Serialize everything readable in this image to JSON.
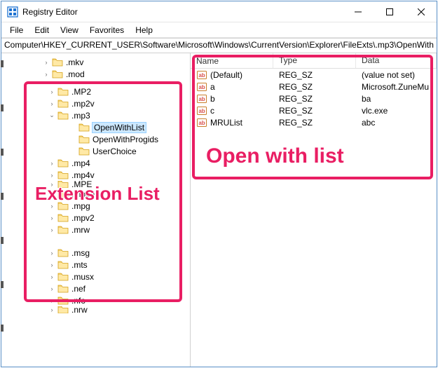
{
  "window": {
    "title": "Registry Editor"
  },
  "menubar": [
    "File",
    "Edit",
    "View",
    "Favorites",
    "Help"
  ],
  "address": "Computer\\HKEY_CURRENT_USER\\Software\\Microsoft\\Windows\\CurrentVersion\\Explorer\\FileExts\\.mp3\\OpenWith",
  "tree": {
    "indent0": [
      {
        "label": ".mkv",
        "tw": "›"
      },
      {
        "label": ".mod",
        "tw": "›"
      }
    ],
    "indent1": [
      {
        "label": ".MP2",
        "tw": "›"
      },
      {
        "label": ".mp2v",
        "tw": "›"
      },
      {
        "label": ".mp3",
        "tw": "v",
        "expanded": true,
        "children": [
          {
            "label": "OpenWithList",
            "selected": true
          },
          {
            "label": "OpenWithProgids"
          },
          {
            "label": "UserChoice"
          }
        ]
      },
      {
        "label": ".mp4",
        "tw": "›"
      },
      {
        "label": ".mp4v",
        "tw": "›"
      },
      {
        "label": ".MPE",
        "tw": "›",
        "cut": true
      },
      {
        "label": ".mpeg",
        "tw": "›"
      },
      {
        "label": ".mpg",
        "tw": "›"
      },
      {
        "label": ".mpv2",
        "tw": "›"
      },
      {
        "label": ".mrw",
        "tw": "›"
      }
    ],
    "indent2": [
      {
        "label": ".msg",
        "tw": "›"
      },
      {
        "label": ".mts",
        "tw": "›"
      },
      {
        "label": ".musx",
        "tw": "›"
      },
      {
        "label": ".nef",
        "tw": "›"
      },
      {
        "label": ".nfo",
        "tw": "›"
      },
      {
        "label": ".nrw",
        "tw": "›",
        "cut": true
      }
    ]
  },
  "list": {
    "columns": {
      "name": "Name",
      "type": "Type",
      "data": "Data"
    },
    "rows": [
      {
        "name": "(Default)",
        "type": "REG_SZ",
        "data": "(value not set)"
      },
      {
        "name": "a",
        "type": "REG_SZ",
        "data": "Microsoft.ZuneMu"
      },
      {
        "name": "b",
        "type": "REG_SZ",
        "data": "ba"
      },
      {
        "name": "c",
        "type": "REG_SZ",
        "data": "vlc.exe"
      },
      {
        "name": "MRUList",
        "type": "REG_SZ",
        "data": "abc"
      }
    ]
  },
  "annotations": {
    "left": "Extension List",
    "right": "Open with list"
  }
}
